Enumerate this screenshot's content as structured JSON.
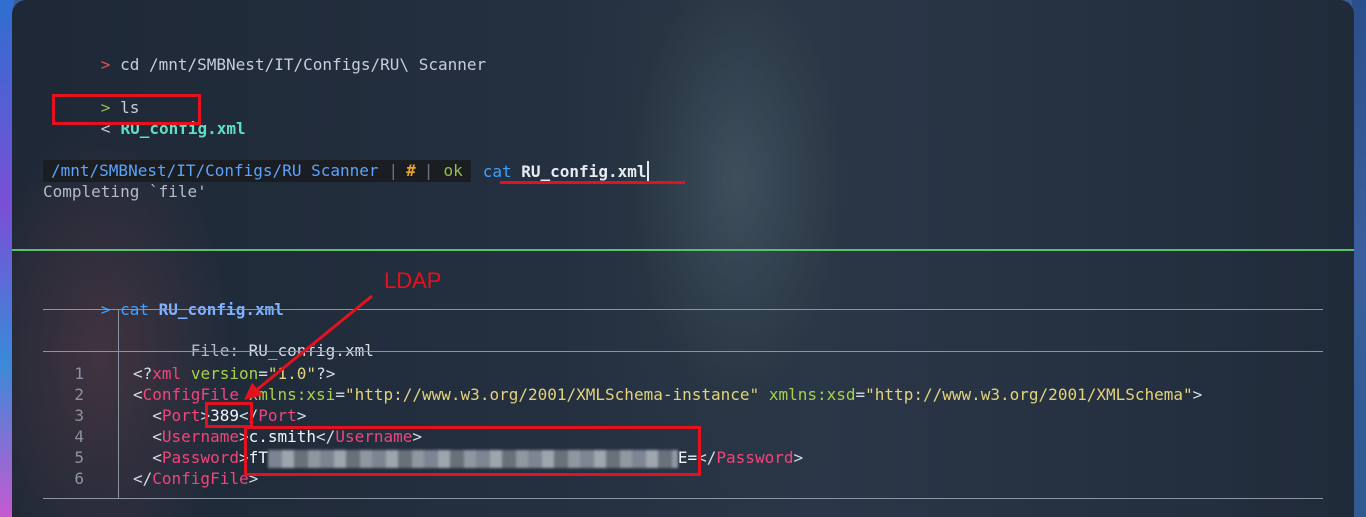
{
  "top_pane": {
    "line1": {
      "prompt": ">",
      "command": "cd /mnt/SMBNest/IT/Configs/RU\\ Scanner"
    },
    "line2": {
      "prompt": ">",
      "command": "ls"
    },
    "line3": {
      "prefix": "<",
      "file": "RU_config.xml"
    },
    "status": {
      "path": "/mnt/SMBNest/IT/Configs/RU Scanner",
      "sep": "|",
      "hash": "#",
      "ok": "ok",
      "cmd": "cat",
      "cmd_file": "RU_config.xml"
    },
    "completion": "Completing `file'"
  },
  "bottom_pane": {
    "prompt": ">",
    "cmd": "cat",
    "cmd_file": "RU_config.xml",
    "file_header": {
      "label": "File:",
      "name": "RU_config.xml"
    },
    "line_numbers": [
      "1",
      "2",
      "3",
      "4",
      "5",
      "6"
    ],
    "code": {
      "l1": {
        "open": "<?",
        "tag": "xml",
        "attr": "version",
        "eq": "=",
        "str": "\"1.0\"",
        "close": "?>"
      },
      "l2": {
        "open": "<",
        "tag": "ConfigFile",
        "attr1": "xmlns:xsi",
        "str1": "\"http://www.w3.org/2001/XMLSchema-instance\"",
        "attr2": "xmlns:xsd",
        "str2": "\"http://www.w3.org/2001/XMLSchema\"",
        "close": ">"
      },
      "l3": {
        "tag": "Port",
        "value": "389"
      },
      "l4": {
        "tag": "Username",
        "value": "c.smith"
      },
      "l5": {
        "tag": "Password",
        "value_start": "fT",
        "value_end": "E="
      },
      "l6": {
        "tag": "ConfigFile"
      }
    }
  },
  "annotation": {
    "label": "LDAP",
    "color": "#e3121e"
  },
  "colors": {
    "accent_red": "#e3121e",
    "divider_green": "#58c26e",
    "tag_pink": "#f0457a",
    "attr_green": "#a6d24a",
    "string_yellow": "#e3d37a"
  }
}
